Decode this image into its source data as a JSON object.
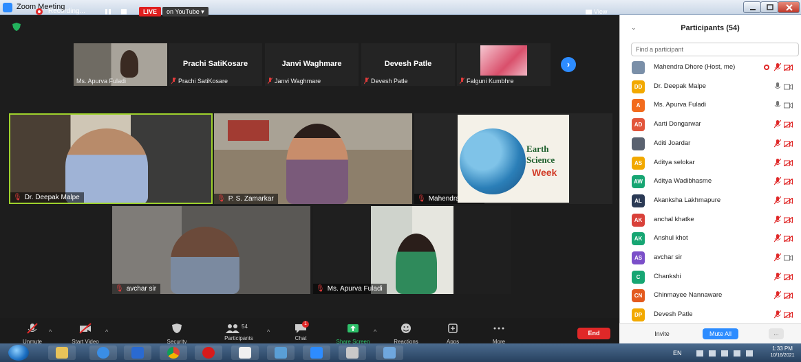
{
  "window": {
    "title": "Zoom Meeting"
  },
  "topbar": {
    "recording_label": "Recording...",
    "live_label": "LIVE",
    "live_platform": "on YouTube",
    "view_label": "View"
  },
  "strip": {
    "tiles": [
      {
        "display": "",
        "label": "Ms. Apurva Fuladi"
      },
      {
        "display": "Prachi SatiKosare",
        "label": "Prachi SatiKosare"
      },
      {
        "display": "Janvi Waghmare",
        "label": "Janvi Waghmare"
      },
      {
        "display": "Devesh Patle",
        "label": "Devesh Patle"
      },
      {
        "display": "",
        "label": "Falguni Kumbhre"
      }
    ],
    "next_glyph": "›"
  },
  "tiles": [
    {
      "label": "Dr. Deepak Malpe"
    },
    {
      "label": "P. S. Zamarkar"
    },
    {
      "label": "Mahendra Dhore"
    },
    {
      "label": "avchar sir"
    },
    {
      "label": "Ms. Apurva Fuladi"
    }
  ],
  "earth_card": {
    "line1": "Earth",
    "line2": "Science",
    "line3": "Week"
  },
  "toolbar": {
    "unmute": "Unmute",
    "start_video": "Start Video",
    "security": "Security",
    "participants": "Participants",
    "participant_count": "54",
    "chat": "Chat",
    "chat_badge": "1",
    "share_screen": "Share Screen",
    "reactions": "Reactions",
    "apps": "Apps",
    "more": "More",
    "end": "End"
  },
  "panel": {
    "collapse_glyph": "⌄",
    "title": "Participants (54)",
    "search_placeholder": "Find a participant",
    "participants": [
      {
        "initials": "",
        "color": "#7a8fa8",
        "name": "Mahendra Dhore (Host, me)",
        "mic": "muted",
        "cam": "off",
        "rec": true
      },
      {
        "initials": "DD",
        "color": "#f2a900",
        "name": "Dr. Deepak Malpe",
        "mic": "on",
        "cam": "on",
        "rec": false
      },
      {
        "initials": "A",
        "color": "#f26b1d",
        "name": "Ms. Apurva Fuladi",
        "mic": "on",
        "cam": "on",
        "rec": false
      },
      {
        "initials": "AD",
        "color": "#e2553b",
        "name": "Aarti Dongarwar",
        "mic": "muted",
        "cam": "off",
        "rec": false
      },
      {
        "initials": "",
        "color": "#5a6270",
        "name": "Aditi Joardar",
        "mic": "muted",
        "cam": "off",
        "rec": false
      },
      {
        "initials": "AS",
        "color": "#f2a900",
        "name": "Aditya selokar",
        "mic": "muted",
        "cam": "off",
        "rec": false
      },
      {
        "initials": "AW",
        "color": "#17a673",
        "name": "Aditya Wadibhasme",
        "mic": "muted",
        "cam": "off",
        "rec": false
      },
      {
        "initials": "AL",
        "color": "#2b3a55",
        "name": "Akanksha Lakhmapure",
        "mic": "muted",
        "cam": "off",
        "rec": false
      },
      {
        "initials": "AK",
        "color": "#d9413a",
        "name": "anchal khatke",
        "mic": "muted",
        "cam": "off",
        "rec": false
      },
      {
        "initials": "AK",
        "color": "#17a673",
        "name": "Anshul khot",
        "mic": "muted",
        "cam": "off",
        "rec": false
      },
      {
        "initials": "AS",
        "color": "#7b4fc9",
        "name": "avchar sir",
        "mic": "muted",
        "cam": "on",
        "rec": false
      },
      {
        "initials": "C",
        "color": "#17a673",
        "name": "Chankshi",
        "mic": "muted",
        "cam": "off",
        "rec": false
      },
      {
        "initials": "CN",
        "color": "#e35a1e",
        "name": "Chinmayee Nannaware",
        "mic": "muted",
        "cam": "off",
        "rec": false
      },
      {
        "initials": "DP",
        "color": "#f2a900",
        "name": "Devesh Patle",
        "mic": "muted",
        "cam": "off",
        "rec": false
      }
    ],
    "invite_label": "Invite",
    "mute_all_label": "Mute All",
    "more_label": "..."
  },
  "taskbar": {
    "lang": "EN",
    "time": "1:33 PM",
    "date": "10/16/2021"
  },
  "colors": {
    "accent": "#2d8cff",
    "danger": "#e02828",
    "active_speaker": "#9fd22c",
    "share": "#2ec16a"
  }
}
